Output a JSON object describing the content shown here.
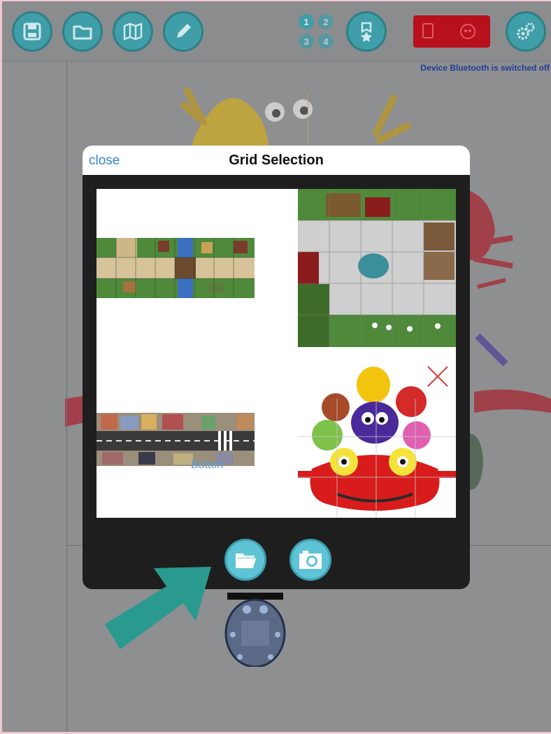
{
  "toolbar": {
    "buttons": [
      {
        "name": "save-icon"
      },
      {
        "name": "folder-icon"
      },
      {
        "name": "map-icon"
      },
      {
        "name": "pencil-icon"
      },
      {
        "name": "badge-icon"
      },
      {
        "name": "gears-icon"
      }
    ],
    "level_numbers": [
      "1",
      "2",
      "3",
      "4"
    ],
    "bluetooth_status": "Device Bluetooth is switched off"
  },
  "modal": {
    "close_label": "close",
    "title": "Grid Selection",
    "grids": [
      {
        "name": "village-river-strip"
      },
      {
        "name": "farm-grid"
      },
      {
        "name": "city-street-strip"
      },
      {
        "name": "characters-car-grid"
      }
    ],
    "button_overlay_text": "Button",
    "actions": [
      {
        "name": "open-folder-button",
        "icon": "folder-icon"
      },
      {
        "name": "camera-button",
        "icon": "camera-icon"
      }
    ]
  },
  "colors": {
    "accent": "#3f9ea7",
    "link": "#2f86d6",
    "arrow": "#2a9a8f",
    "bluetooth_widget": "#b8101c",
    "status_text": "#1f3f96"
  }
}
